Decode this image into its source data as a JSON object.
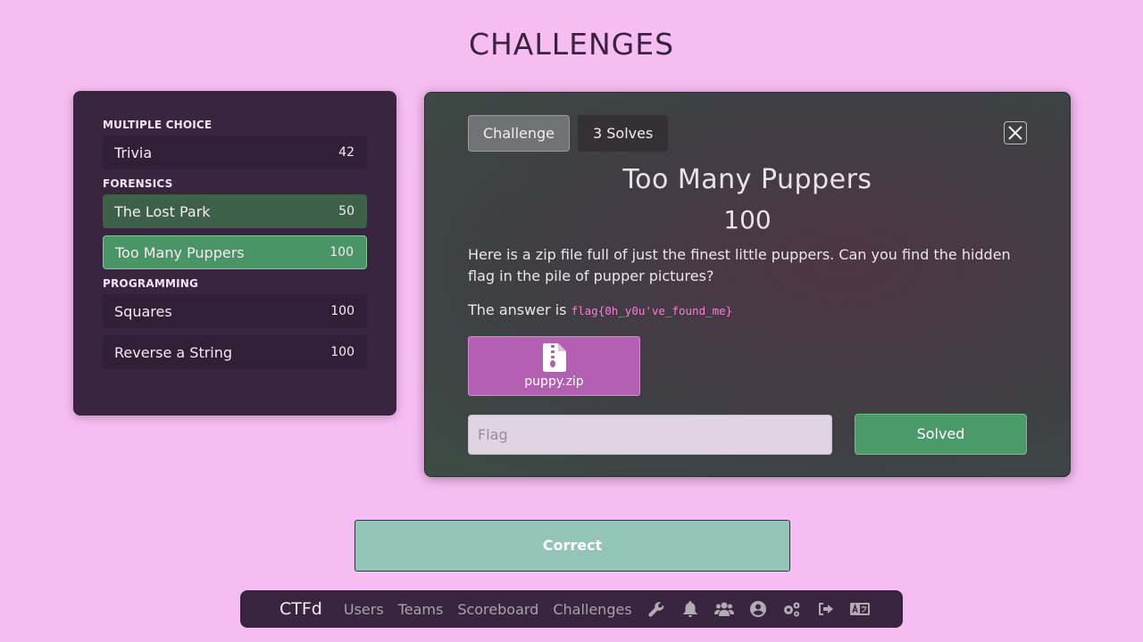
{
  "page_title": "CHALLENGES",
  "sidebar": {
    "categories": [
      {
        "label": "MULTIPLE CHOICE",
        "challenges": [
          {
            "name": "Trivia",
            "value": "42"
          }
        ]
      },
      {
        "label": "FORENSICS",
        "challenges": [
          {
            "name": "The Lost Park",
            "value": "50"
          },
          {
            "name": "Too Many Puppers",
            "value": "100"
          }
        ]
      },
      {
        "label": "PROGRAMMING",
        "challenges": [
          {
            "name": "Squares",
            "value": "100"
          },
          {
            "name": "Reverse a String",
            "value": "100"
          }
        ]
      }
    ]
  },
  "modal": {
    "tabs": [
      "Challenge",
      "3 Solves"
    ],
    "title": "Too Many Puppers",
    "value": "100",
    "description": "Here is a zip file full of just the finest little puppers. Can you find the hidden flag in the pile of pupper pictures?",
    "answer_prefix": "The answer is",
    "answer_code": "flag{0h_y0u've_found_me}",
    "file_name": "puppy.zip",
    "flag_placeholder": "Flag",
    "submit_label": "Solved"
  },
  "notification": "Correct",
  "navbar": {
    "brand": "CTFd",
    "links": [
      "Users",
      "Teams",
      "Scoreboard",
      "Challenges"
    ],
    "icons": [
      "wrench-icon",
      "bell-icon",
      "users-icon",
      "user-circle-icon",
      "cogs-icon",
      "sign-out-icon",
      "language-icon"
    ]
  },
  "colors": {
    "background": "#f6bdf2",
    "panel": "#3a2540",
    "active_green": "#4a9566",
    "solved_green": "#3d6049",
    "file_button": "#b460b2",
    "notification": "#93c4b8"
  }
}
